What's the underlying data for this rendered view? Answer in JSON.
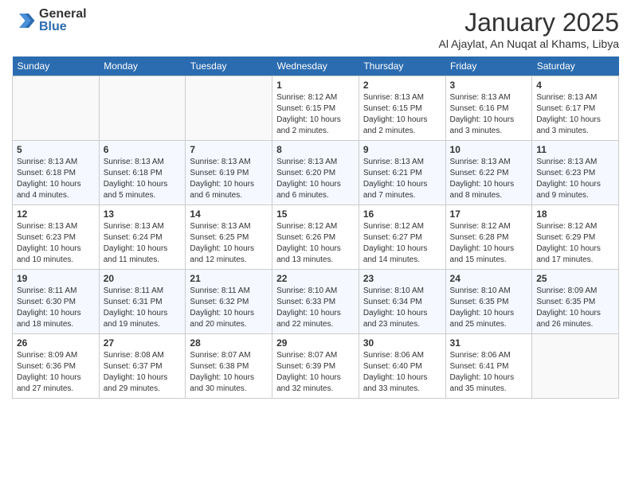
{
  "header": {
    "logo_general": "General",
    "logo_blue": "Blue",
    "month_title": "January 2025",
    "location": "Al Ajaylat, An Nuqat al Khams, Libya"
  },
  "days_of_week": [
    "Sunday",
    "Monday",
    "Tuesday",
    "Wednesday",
    "Thursday",
    "Friday",
    "Saturday"
  ],
  "weeks": [
    [
      {
        "day": "",
        "sunrise": "",
        "sunset": "",
        "daylight": ""
      },
      {
        "day": "",
        "sunrise": "",
        "sunset": "",
        "daylight": ""
      },
      {
        "day": "",
        "sunrise": "",
        "sunset": "",
        "daylight": ""
      },
      {
        "day": "1",
        "sunrise": "Sunrise: 8:12 AM",
        "sunset": "Sunset: 6:15 PM",
        "daylight": "Daylight: 10 hours and 2 minutes."
      },
      {
        "day": "2",
        "sunrise": "Sunrise: 8:13 AM",
        "sunset": "Sunset: 6:15 PM",
        "daylight": "Daylight: 10 hours and 2 minutes."
      },
      {
        "day": "3",
        "sunrise": "Sunrise: 8:13 AM",
        "sunset": "Sunset: 6:16 PM",
        "daylight": "Daylight: 10 hours and 3 minutes."
      },
      {
        "day": "4",
        "sunrise": "Sunrise: 8:13 AM",
        "sunset": "Sunset: 6:17 PM",
        "daylight": "Daylight: 10 hours and 3 minutes."
      }
    ],
    [
      {
        "day": "5",
        "sunrise": "Sunrise: 8:13 AM",
        "sunset": "Sunset: 6:18 PM",
        "daylight": "Daylight: 10 hours and 4 minutes."
      },
      {
        "day": "6",
        "sunrise": "Sunrise: 8:13 AM",
        "sunset": "Sunset: 6:18 PM",
        "daylight": "Daylight: 10 hours and 5 minutes."
      },
      {
        "day": "7",
        "sunrise": "Sunrise: 8:13 AM",
        "sunset": "Sunset: 6:19 PM",
        "daylight": "Daylight: 10 hours and 6 minutes."
      },
      {
        "day": "8",
        "sunrise": "Sunrise: 8:13 AM",
        "sunset": "Sunset: 6:20 PM",
        "daylight": "Daylight: 10 hours and 6 minutes."
      },
      {
        "day": "9",
        "sunrise": "Sunrise: 8:13 AM",
        "sunset": "Sunset: 6:21 PM",
        "daylight": "Daylight: 10 hours and 7 minutes."
      },
      {
        "day": "10",
        "sunrise": "Sunrise: 8:13 AM",
        "sunset": "Sunset: 6:22 PM",
        "daylight": "Daylight: 10 hours and 8 minutes."
      },
      {
        "day": "11",
        "sunrise": "Sunrise: 8:13 AM",
        "sunset": "Sunset: 6:23 PM",
        "daylight": "Daylight: 10 hours and 9 minutes."
      }
    ],
    [
      {
        "day": "12",
        "sunrise": "Sunrise: 8:13 AM",
        "sunset": "Sunset: 6:23 PM",
        "daylight": "Daylight: 10 hours and 10 minutes."
      },
      {
        "day": "13",
        "sunrise": "Sunrise: 8:13 AM",
        "sunset": "Sunset: 6:24 PM",
        "daylight": "Daylight: 10 hours and 11 minutes."
      },
      {
        "day": "14",
        "sunrise": "Sunrise: 8:13 AM",
        "sunset": "Sunset: 6:25 PM",
        "daylight": "Daylight: 10 hours and 12 minutes."
      },
      {
        "day": "15",
        "sunrise": "Sunrise: 8:12 AM",
        "sunset": "Sunset: 6:26 PM",
        "daylight": "Daylight: 10 hours and 13 minutes."
      },
      {
        "day": "16",
        "sunrise": "Sunrise: 8:12 AM",
        "sunset": "Sunset: 6:27 PM",
        "daylight": "Daylight: 10 hours and 14 minutes."
      },
      {
        "day": "17",
        "sunrise": "Sunrise: 8:12 AM",
        "sunset": "Sunset: 6:28 PM",
        "daylight": "Daylight: 10 hours and 15 minutes."
      },
      {
        "day": "18",
        "sunrise": "Sunrise: 8:12 AM",
        "sunset": "Sunset: 6:29 PM",
        "daylight": "Daylight: 10 hours and 17 minutes."
      }
    ],
    [
      {
        "day": "19",
        "sunrise": "Sunrise: 8:11 AM",
        "sunset": "Sunset: 6:30 PM",
        "daylight": "Daylight: 10 hours and 18 minutes."
      },
      {
        "day": "20",
        "sunrise": "Sunrise: 8:11 AM",
        "sunset": "Sunset: 6:31 PM",
        "daylight": "Daylight: 10 hours and 19 minutes."
      },
      {
        "day": "21",
        "sunrise": "Sunrise: 8:11 AM",
        "sunset": "Sunset: 6:32 PM",
        "daylight": "Daylight: 10 hours and 20 minutes."
      },
      {
        "day": "22",
        "sunrise": "Sunrise: 8:10 AM",
        "sunset": "Sunset: 6:33 PM",
        "daylight": "Daylight: 10 hours and 22 minutes."
      },
      {
        "day": "23",
        "sunrise": "Sunrise: 8:10 AM",
        "sunset": "Sunset: 6:34 PM",
        "daylight": "Daylight: 10 hours and 23 minutes."
      },
      {
        "day": "24",
        "sunrise": "Sunrise: 8:10 AM",
        "sunset": "Sunset: 6:35 PM",
        "daylight": "Daylight: 10 hours and 25 minutes."
      },
      {
        "day": "25",
        "sunrise": "Sunrise: 8:09 AM",
        "sunset": "Sunset: 6:35 PM",
        "daylight": "Daylight: 10 hours and 26 minutes."
      }
    ],
    [
      {
        "day": "26",
        "sunrise": "Sunrise: 8:09 AM",
        "sunset": "Sunset: 6:36 PM",
        "daylight": "Daylight: 10 hours and 27 minutes."
      },
      {
        "day": "27",
        "sunrise": "Sunrise: 8:08 AM",
        "sunset": "Sunset: 6:37 PM",
        "daylight": "Daylight: 10 hours and 29 minutes."
      },
      {
        "day": "28",
        "sunrise": "Sunrise: 8:07 AM",
        "sunset": "Sunset: 6:38 PM",
        "daylight": "Daylight: 10 hours and 30 minutes."
      },
      {
        "day": "29",
        "sunrise": "Sunrise: 8:07 AM",
        "sunset": "Sunset: 6:39 PM",
        "daylight": "Daylight: 10 hours and 32 minutes."
      },
      {
        "day": "30",
        "sunrise": "Sunrise: 8:06 AM",
        "sunset": "Sunset: 6:40 PM",
        "daylight": "Daylight: 10 hours and 33 minutes."
      },
      {
        "day": "31",
        "sunrise": "Sunrise: 8:06 AM",
        "sunset": "Sunset: 6:41 PM",
        "daylight": "Daylight: 10 hours and 35 minutes."
      },
      {
        "day": "",
        "sunrise": "",
        "sunset": "",
        "daylight": ""
      }
    ]
  ]
}
